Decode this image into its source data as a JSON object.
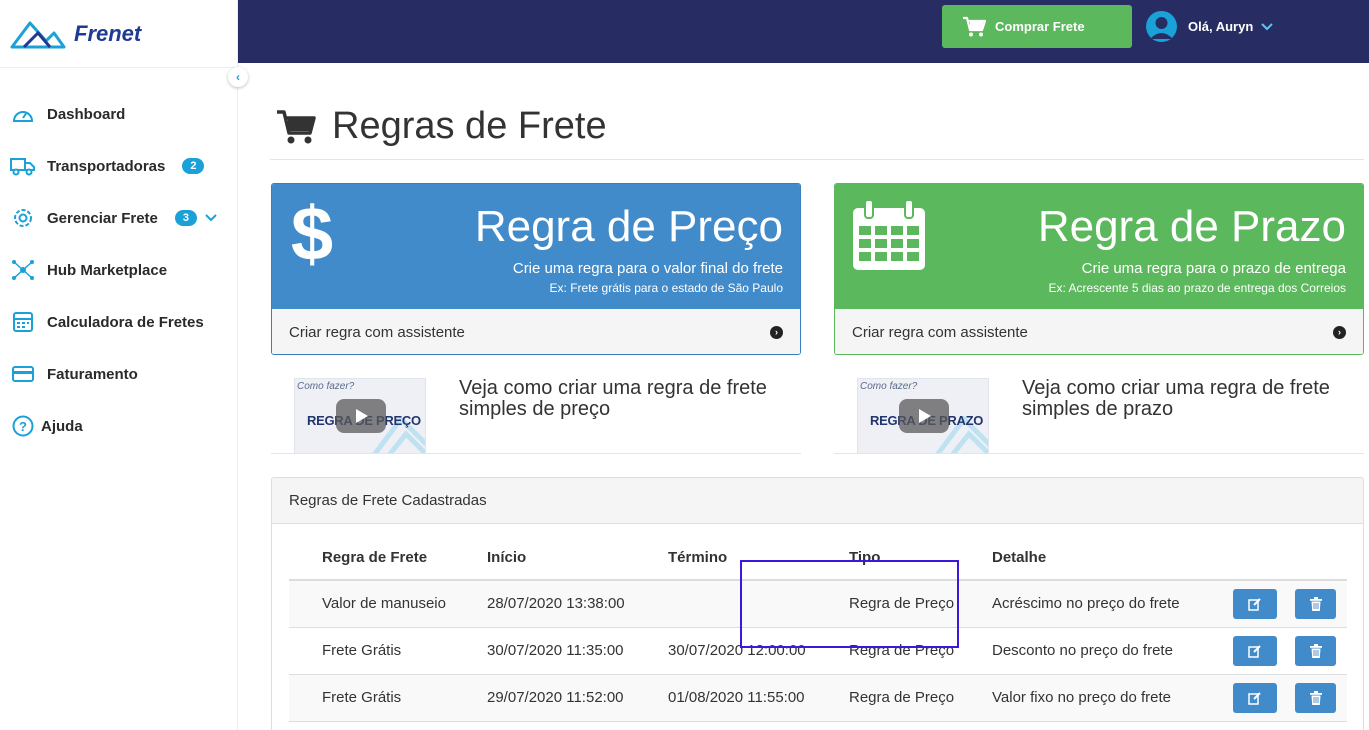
{
  "brand": {
    "name": "Frenet"
  },
  "sidebar": {
    "collapse_icon": "‹",
    "items": [
      {
        "label": "Dashboard",
        "icon": "dashboard-icon"
      },
      {
        "label": "Transportadoras",
        "icon": "truck-icon",
        "badge": "2"
      },
      {
        "label": "Gerenciar Frete",
        "icon": "gear-icon",
        "badge": "3"
      },
      {
        "label": "Hub Marketplace",
        "icon": "hub-icon"
      },
      {
        "label": "Calculadora de Fretes",
        "icon": "calculator-icon"
      },
      {
        "label": "Faturamento",
        "icon": "credit-card-icon"
      },
      {
        "label": "Ajuda",
        "icon": "help-icon"
      }
    ]
  },
  "topbar": {
    "buy_label": "Comprar Frete",
    "user_greeting": "Olá, Auryn"
  },
  "page": {
    "title": "Regras de Frete"
  },
  "cards": {
    "price": {
      "title": "Regra de Preço",
      "subtitle": "Crie uma regra para o valor final do frete",
      "example": "Ex: Frete grátis para o estado de São Paulo",
      "action": "Criar regra com assistente",
      "color": "#428bca"
    },
    "prazo": {
      "title": "Regra de Prazo",
      "subtitle": "Crie uma regra para o prazo de entrega",
      "example": "Ex: Acrescente 5 dias ao prazo de entrega dos Correios",
      "action": "Criar regra com assistente",
      "color": "#5cb85c"
    }
  },
  "videos": {
    "price": {
      "thumb_small": "Como fazer?",
      "thumb_title": "REGRA DE PREÇO",
      "text": "Veja como criar uma regra de frete simples de preço"
    },
    "prazo": {
      "thumb_small": "Como fazer?",
      "thumb_title": "REGRA DE PRAZO",
      "text": "Veja como criar uma regra de frete simples de prazo"
    }
  },
  "rules_panel": {
    "title": "Regras de Frete Cadastradas",
    "columns": [
      "Regra de Frete",
      "Início",
      "Término",
      "Tipo",
      "Detalhe"
    ],
    "rows": [
      {
        "name": "Valor de manuseio",
        "start": "28/07/2020 13:38:00",
        "end": "",
        "type": "Regra de Preço",
        "detail": "Acréscimo no preço do frete"
      },
      {
        "name": "Frete Grátis",
        "start": "30/07/2020 11:35:00",
        "end": "30/07/2020 12:00:00",
        "type": "Regra de Preço",
        "detail": "Desconto no preço do frete"
      },
      {
        "name": "Frete Grátis",
        "start": "29/07/2020 11:52:00",
        "end": "01/08/2020 11:55:00",
        "type": "Regra de Preço",
        "detail": "Valor fixo no preço do frete"
      }
    ]
  }
}
